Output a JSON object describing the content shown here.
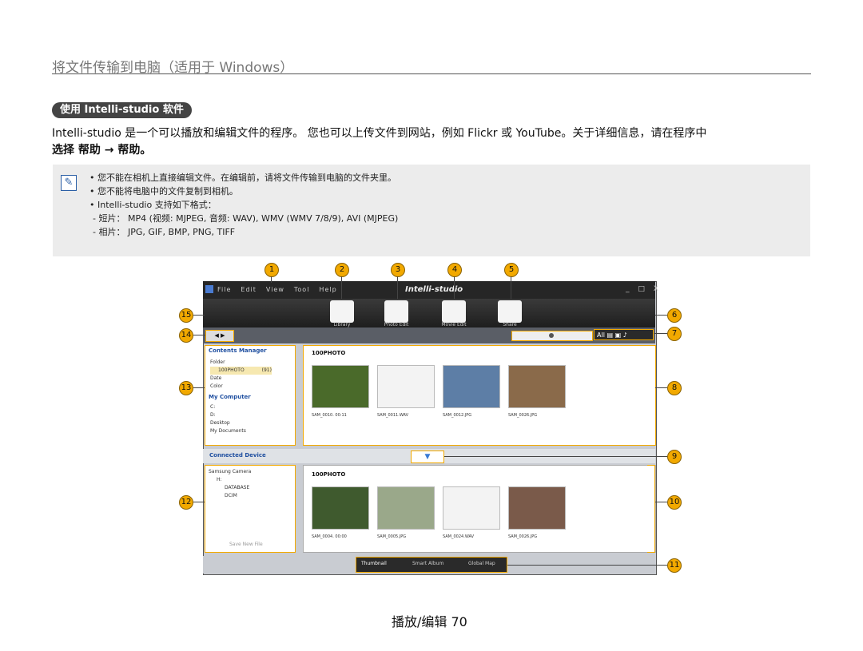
{
  "header": {
    "title": "将文件传输到电脑（适用于 Windows）"
  },
  "section": {
    "pill": "使用 Intelli-studio 软件"
  },
  "intro": {
    "line1": "Intelli-studio 是一个可以播放和编辑文件的程序。 您也可以上传文件到网站，例如 Flickr 或 YouTube。关于详细信息，请在程序中",
    "line2": "选择 帮助 → 帮助。"
  },
  "note": {
    "bullets": [
      "您不能在相机上直接编辑文件。在编辑前，请将文件传输到电脑的文件夹里。",
      "您不能将电脑中的文件复制到相机。",
      "Intelli-studio 支持如下格式："
    ],
    "sub": [
      "- 短片： MP4 (视频: MJPEG, 音频: WAV), WMV (WMV 7/8/9), AVI (MJPEG)",
      "- 相片： JPG, GIF, BMP, PNG, TIFF"
    ]
  },
  "callouts": [
    "1",
    "2",
    "3",
    "4",
    "5",
    "6",
    "7",
    "8",
    "9",
    "10",
    "11",
    "12",
    "13",
    "14",
    "15"
  ],
  "app": {
    "menu": [
      "File",
      "Edit",
      "View",
      "Tool",
      "Help"
    ],
    "brand": "Intelli-studio",
    "window_controls": "_ □ X",
    "toolbar": [
      "Library",
      "Photo Edit",
      "Movie Edit",
      "Share"
    ],
    "view_modes": [
      "All"
    ],
    "left_top": {
      "title": "Contents Manager",
      "items": [
        "Folder",
        "100PHOTO",
        "(91)",
        "Date",
        "Color"
      ],
      "computer_title": "My Computer",
      "computer_items": [
        "C:",
        "D:",
        "Desktop",
        "My Documents"
      ]
    },
    "top_folder": "100PHOTO",
    "top_files": [
      "SAM_0010.  00:11",
      "SAM_0011.WAV",
      "SAM_0012.JPG",
      "SAM_0026.JPG"
    ],
    "connected": "Connected Device",
    "left_bottom": {
      "items": [
        "Samsung Camera",
        "H:",
        "DATABASE",
        "DCIM"
      ],
      "save": "Save New File"
    },
    "bottom_folder": "100PHOTO",
    "bottom_files": [
      "SAM_0004.  00:00",
      "SAM_0005.JPG",
      "SAM_0024.WAV",
      "SAM_0026.JPG"
    ],
    "tabs": [
      "Thumbnail",
      "Smart Album",
      "Global Map"
    ]
  },
  "footer": {
    "text": "播放/编辑 70"
  }
}
